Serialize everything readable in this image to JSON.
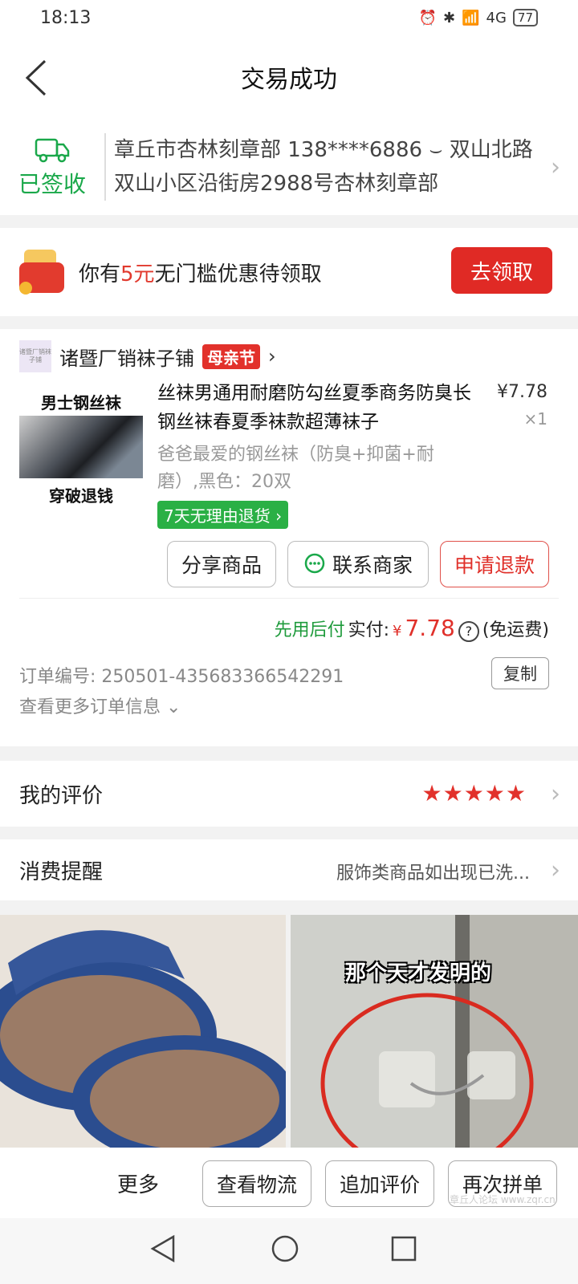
{
  "status_bar": {
    "time": "18:13",
    "network": "4G",
    "battery": "77"
  },
  "header": {
    "title": "交易成功"
  },
  "address": {
    "status": "已签收",
    "text": "章丘市杏林刻章部 138****6886 ⌣ 双山北路双山小区沿街房2988号杏林刻章部"
  },
  "coupon": {
    "prefix": "你有",
    "amount": "5元",
    "suffix": "无门槛优惠待领取",
    "button": "去领取"
  },
  "order": {
    "shop_logo_text": "诸暨厂销袜子铺",
    "shop_name": "诸暨厂销袜子铺",
    "festival_badge": "母亲节",
    "thumb_top": "男士钢丝袜",
    "thumb_bottom": "穿破退钱",
    "title": "丝袜男通用耐磨防勾丝夏季商务防臭长钢丝袜春夏季袜款超薄袜子",
    "price": "¥7.78",
    "qty": "×1",
    "spec": "爸爸最爱的钢丝袜（防臭+抑菌+耐磨）,黑色：20双",
    "return_badge": "7天无理由退货 ›",
    "btn_share": "分享商品",
    "btn_contact": "联系商家",
    "btn_refund": "申请退款",
    "pay_green": "先用后付",
    "pay_label": "实付:",
    "pay_currency": "¥",
    "pay_amount": "7.78",
    "pay_note": "(免运费)"
  },
  "order_info": {
    "number": "订单编号:  250501-435683366542291",
    "more": "查看更多订单信息 ⌄",
    "copy": "复制"
  },
  "review": {
    "label": "我的评价",
    "stars": "★★★★★",
    "rating": 5
  },
  "reminder": {
    "label": "消费提醒",
    "value": "服饰类商品如出现已洗..."
  },
  "recommend": {
    "right_caption": "那个天才发明的"
  },
  "bottom_bar": {
    "more": "更多",
    "logistics": "查看物流",
    "add_review": "追加评价",
    "reorder": "再次拼单"
  },
  "watermark": "章丘人论坛 www.zqr.cn",
  "colors": {
    "accent_red": "#e02a25",
    "green": "#1aa84a"
  }
}
